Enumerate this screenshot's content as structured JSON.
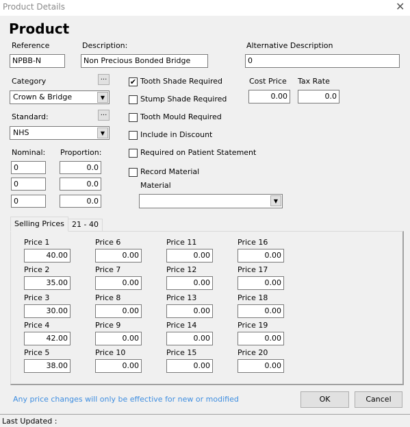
{
  "window": {
    "title": "Product Details",
    "close": "✕"
  },
  "heading": "Product",
  "fields": {
    "reference": {
      "label": "Reference",
      "value": "NPBB-N"
    },
    "description": {
      "label": "Description:",
      "value": "Non Precious Bonded Bridge"
    },
    "alt_description": {
      "label": "Alternative Description",
      "value": "0"
    },
    "category": {
      "label": "Category",
      "value": "Crown & Bridge",
      "more": "..."
    },
    "standard": {
      "label": "Standard:",
      "value": "NHS",
      "more": "..."
    },
    "nominal": {
      "label": "Nominal:",
      "values": [
        "0",
        "0",
        "0"
      ]
    },
    "proportion": {
      "label": "Proportion:",
      "values": [
        "0.0",
        "0.0",
        "0.0"
      ]
    },
    "cost_price": {
      "label": "Cost Price",
      "value": "0.00"
    },
    "tax_rate": {
      "label": "Tax Rate",
      "value": "0.0"
    },
    "material": {
      "label": "Material",
      "value": ""
    }
  },
  "checkboxes": [
    {
      "label": "Tooth Shade Required",
      "checked": true
    },
    {
      "label": "Stump Shade Required",
      "checked": false
    },
    {
      "label": "Tooth Mould Required",
      "checked": false
    },
    {
      "label": "Include in Discount",
      "checked": false
    },
    {
      "label": "Required on Patient Statement",
      "checked": false
    },
    {
      "label": "Record Material",
      "checked": false
    }
  ],
  "tabs": [
    {
      "label": "Selling Prices",
      "active": true
    },
    {
      "label": "21 - 40",
      "active": false
    }
  ],
  "prices": [
    {
      "label": "Price 1",
      "value": "40.00"
    },
    {
      "label": "Price 2",
      "value": "35.00"
    },
    {
      "label": "Price 3",
      "value": "30.00"
    },
    {
      "label": "Price 4",
      "value": "42.00"
    },
    {
      "label": "Price 5",
      "value": "38.00"
    },
    {
      "label": "Price 6",
      "value": "0.00"
    },
    {
      "label": "Price 7",
      "value": "0.00"
    },
    {
      "label": "Price 8",
      "value": "0.00"
    },
    {
      "label": "Price 9",
      "value": "0.00"
    },
    {
      "label": "Price 10",
      "value": "0.00"
    },
    {
      "label": "Price 11",
      "value": "0.00"
    },
    {
      "label": "Price 12",
      "value": "0.00"
    },
    {
      "label": "Price 13",
      "value": "0.00"
    },
    {
      "label": "Price 14",
      "value": "0.00"
    },
    {
      "label": "Price 15",
      "value": "0.00"
    },
    {
      "label": "Price 16",
      "value": "0.00"
    },
    {
      "label": "Price 17",
      "value": "0.00"
    },
    {
      "label": "Price 18",
      "value": "0.00"
    },
    {
      "label": "Price 19",
      "value": "0.00"
    },
    {
      "label": "Price 20",
      "value": "0.00"
    }
  ],
  "note": "Any price changes will only be effective for new or modified",
  "buttons": {
    "ok": "OK",
    "cancel": "Cancel"
  },
  "status": {
    "last_updated": "Last Updated :"
  }
}
